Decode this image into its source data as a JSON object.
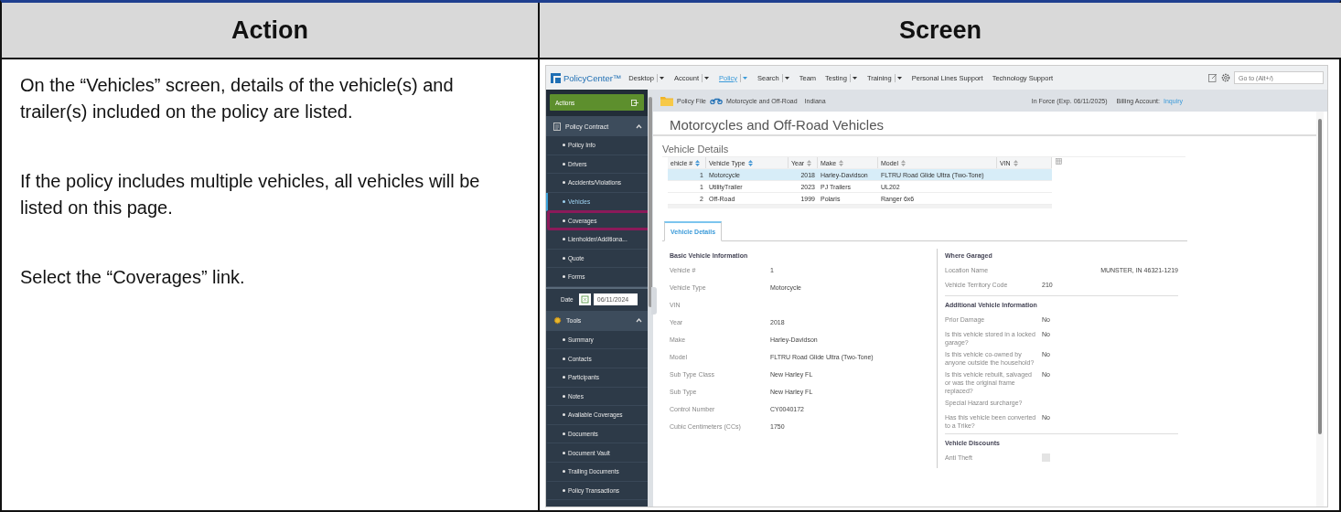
{
  "document": {
    "headers": [
      "Action",
      "Screen"
    ],
    "instructions": [
      "On the “Vehicles” screen, details of the vehicle(s) and trailer(s) included on the policy are listed.",
      "If the policy includes multiple vehicles, all vehicles will be listed on this page.",
      "Select the “Coverages” link."
    ]
  },
  "app": {
    "logo": "PolicyCenter™",
    "nav": [
      {
        "label": "Desktop",
        "selected": false,
        "dropdown": true
      },
      {
        "label": "Account",
        "selected": false,
        "dropdown": true
      },
      {
        "label": "Policy",
        "selected": true,
        "dropdown": true
      },
      {
        "label": "Search",
        "selected": false,
        "dropdown": true
      },
      {
        "label": "Team",
        "selected": false,
        "dropdown": false
      },
      {
        "label": "Testing",
        "selected": false,
        "dropdown": true
      },
      {
        "label": "Training",
        "selected": false,
        "dropdown": true
      },
      {
        "label": "Personal Lines Support",
        "selected": false,
        "dropdown": false
      },
      {
        "label": "Technology Support",
        "selected": false,
        "dropdown": false
      }
    ],
    "goto": {
      "placeholder": "Go to (Alt+/)"
    },
    "actions_label": "Actions",
    "sidebar": [
      {
        "kind": "section",
        "title": "Policy Contract",
        "expanded": true,
        "items": [
          {
            "label": "Policy Info",
            "selected": false,
            "highlighted": false
          },
          {
            "label": "Drivers",
            "selected": false,
            "highlighted": false
          },
          {
            "label": "Accidents/Violations",
            "selected": false,
            "highlighted": false
          },
          {
            "label": "Vehicles",
            "selected": true,
            "highlighted": false
          },
          {
            "label": "Coverages",
            "selected": false,
            "highlighted": true
          },
          {
            "label": "Lienholder/Additiona...",
            "selected": false,
            "highlighted": false
          },
          {
            "label": "Quote",
            "selected": false,
            "highlighted": false
          },
          {
            "label": "Forms",
            "selected": false,
            "highlighted": false
          }
        ]
      },
      {
        "kind": "date",
        "label": "Date",
        "value": "06/11/2024"
      },
      {
        "kind": "section",
        "title": "Tools",
        "expanded": true,
        "items": [
          {
            "label": "Summary",
            "selected": false,
            "highlighted": false
          },
          {
            "label": "Contacts",
            "selected": false,
            "highlighted": false
          },
          {
            "label": "Participants",
            "selected": false,
            "highlighted": false
          },
          {
            "label": "Notes",
            "selected": false,
            "highlighted": false
          },
          {
            "label": "Available Coverages",
            "selected": false,
            "highlighted": false
          },
          {
            "label": "Documents",
            "selected": false,
            "highlighted": false
          },
          {
            "label": "Document Vault",
            "selected": false,
            "highlighted": false
          },
          {
            "label": "Trailing Documents",
            "selected": false,
            "highlighted": false
          },
          {
            "label": "Policy Transactions",
            "selected": false,
            "highlighted": false
          }
        ]
      }
    ],
    "breadcrumb": {
      "items": [
        "Policy File",
        "Motorcycle and Off-Road",
        "Indiana"
      ],
      "status": "In Force (Exp. 06/11/2025)",
      "billing_label": "Billing Account:",
      "billing_link": "Inquiry"
    },
    "page_title": "Motorcycles and Off-Road Vehicles",
    "list_title": "Vehicle Details",
    "table": {
      "columns": [
        "ehicle #",
        "Vehicle Type",
        "Year",
        "Make",
        "Model",
        "VIN"
      ],
      "rows": [
        {
          "cells": [
            "1",
            "Motorcycle",
            "2018",
            "Harley-Davidson",
            "FLTRU Road Glide Ultra (Two-Tone)"
          ],
          "selected": true
        },
        {
          "cells": [
            "1",
            "UtilityTrailer",
            "2023",
            "PJ Trailers",
            "UL202"
          ],
          "selected": false
        },
        {
          "cells": [
            "2",
            "Off-Road",
            "1999",
            "Polaris",
            "Ranger 6x6"
          ],
          "selected": false
        }
      ]
    },
    "tabs": [
      {
        "label": "Vehicle Details",
        "selected": true
      }
    ],
    "left_sections": [
      {
        "title": "Basic Vehicle Information",
        "fields": [
          {
            "label": "Vehicle #",
            "value": "1"
          },
          {
            "label": "Vehicle Type",
            "value": "Motorcycle"
          },
          {
            "label": "VIN"
          },
          {
            "label": "Year",
            "value": "2018"
          },
          {
            "label": "Make",
            "value": "Harley-Davidson"
          },
          {
            "label": "Model",
            "value": "FLTRU Road Glide Ultra (Two-Tone)"
          },
          {
            "label": "Sub Type Class",
            "value": "New Harley FL"
          },
          {
            "label": "Sub Type",
            "value": "New Harley FL"
          },
          {
            "label": "Control Number",
            "value": "CY0040172"
          },
          {
            "label": "Cubic Centimeters (CCs)",
            "value": "1750"
          }
        ]
      }
    ],
    "right_sections": [
      {
        "title": "Where Garaged",
        "fields": [
          {
            "kind": "wide",
            "label": "Location Name",
            "value": "MUNSTER, IN 46321-1219"
          },
          {
            "kind": "text",
            "label": "Vehicle Territory Code",
            "value": "210"
          }
        ]
      },
      {
        "title": "Additional Vehicle Information",
        "fields": [
          {
            "kind": "text",
            "label": "Prior Damage",
            "value": "No"
          },
          {
            "kind": "text",
            "label": "Is this vehicle stored in a locked garage?",
            "value": "No"
          },
          {
            "kind": "text",
            "label": "Is this vehicle co-owned by anyone outside the household?",
            "value": "No"
          },
          {
            "kind": "text",
            "label": "Is this vehicle rebuilt, salvaged or was the original frame replaced?",
            "value": "No"
          },
          {
            "kind": "text",
            "label": "Special Hazard surcharge?"
          },
          {
            "kind": "text",
            "label": "Has this vehicle been converted to a Trike?",
            "value": "No"
          }
        ]
      },
      {
        "title": "Vehicle Discounts",
        "fields": [
          {
            "kind": "checkbox",
            "label": "Anti Theft",
            "checked": false
          }
        ]
      }
    ]
  }
}
